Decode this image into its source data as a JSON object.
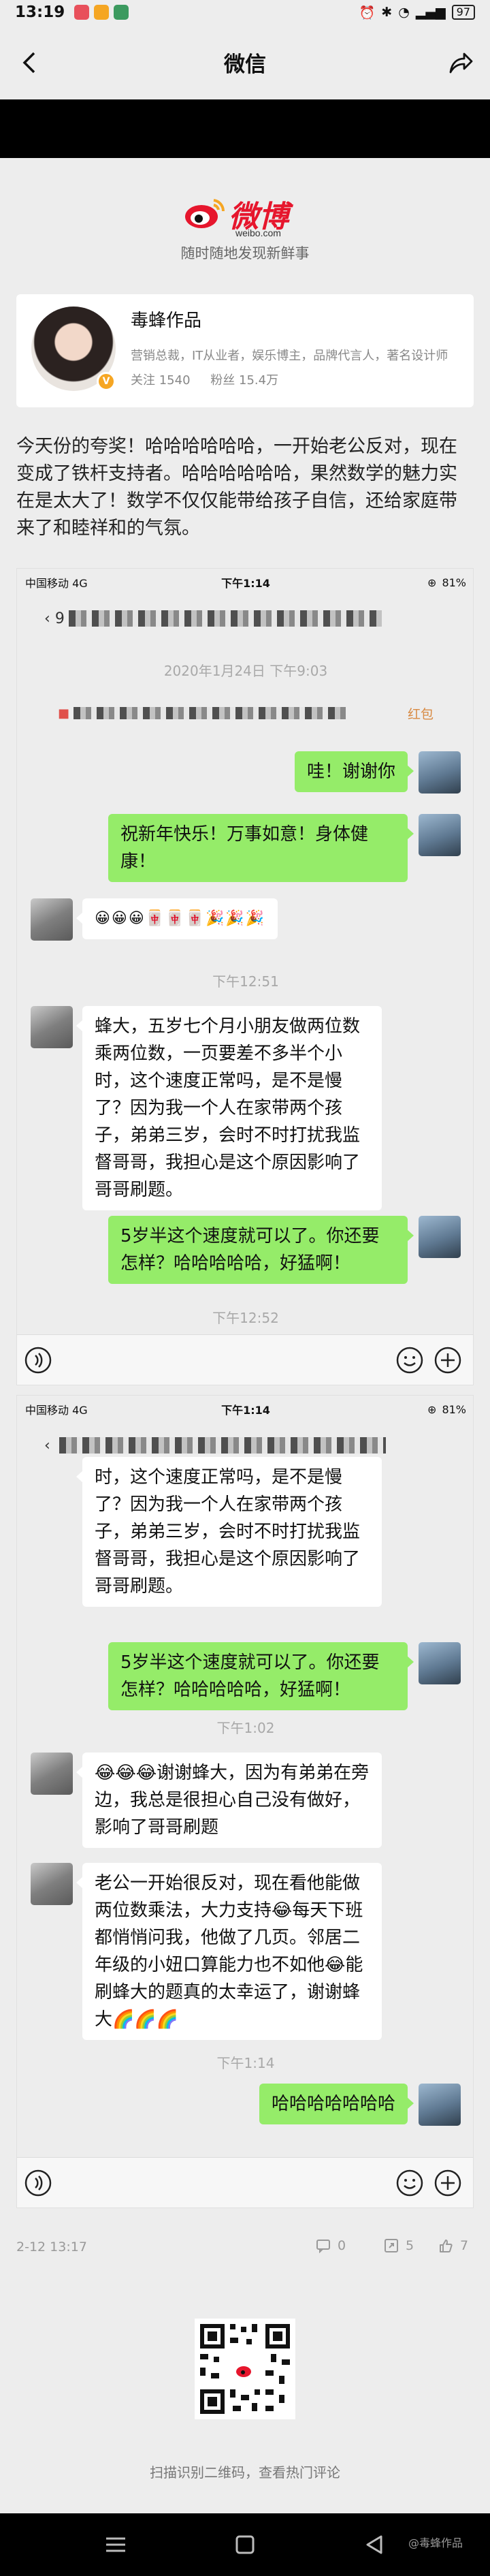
{
  "status_bar": {
    "time": "13:19",
    "battery": "97"
  },
  "header": {
    "title": "微信"
  },
  "weibo": {
    "logo_text": "微博",
    "url": "weibo.com",
    "slogan": "随时随地发现新鲜事"
  },
  "profile": {
    "name": "毒蜂作品",
    "desc": "营销总裁，IT从业者，娱乐博主，品牌代言人，著名设计师",
    "follow": "关注 1540",
    "fans": "粉丝 15.4万",
    "badge": "V"
  },
  "post_text": "今天份的夸奖！哈哈哈哈哈哈，一开始老公反对，现在变成了铁杆支持者。哈哈哈哈哈哈，果然数学的魅力实在是太大了！数学不仅仅能带给孩子自信，还给家庭带来了和睦祥和的气氛。",
  "shot1": {
    "carrier": "中国移动  4G",
    "time": "下午1:14",
    "battery": "81%",
    "chat_prefix": "9",
    "timestamp1": "2020年1月24日 下午9:03",
    "red_packet": "红包",
    "msg1": "哇！谢谢你",
    "msg2": "祝新年快乐！万事如意！身体健康！",
    "emoji_row": "😀😀😀🀄🀄🀄🎉🎉🎉",
    "timestamp2": "下午12:51",
    "msg3": "蜂大，五岁七个月小朋友做两位数乘两位数，一页要差不多半个小时，这个速度正常吗，是不是慢了？因为我一个人在家带两个孩子，弟弟三岁，会时不时打扰我监督哥哥，我担心是这个原因影响了哥哥刷题。",
    "msg4": "5岁半这个速度就可以了。你还要怎样？哈哈哈哈哈，好猛啊！",
    "timestamp3": "下午12:52"
  },
  "shot2": {
    "carrier": "中国移动  4G",
    "time": "下午1:14",
    "battery": "81%",
    "msg1": "时，这个速度正常吗，是不是慢了？因为我一个人在家带两个孩子，弟弟三岁，会时不时打扰我监督哥哥，我担心是这个原因影响了哥哥刷题。",
    "msg2": "5岁半这个速度就可以了。你还要怎样？哈哈哈哈哈，好猛啊！",
    "timestamp1": "下午1:02",
    "msg3": "😂😂😂谢谢蜂大，因为有弟弟在旁边，我总是很担心自己没有做好，影响了哥哥刷题",
    "msg4": "老公一开始很反对，现在看他能做两位数乘法，大力支持😂每天下班都悄悄问我，他做了几页。邻居二年级的小妞口算能力也不如他😂能刷蜂大的题真的太幸运了，谢谢蜂大🌈🌈🌈",
    "timestamp2": "下午1:14",
    "msg5": "哈哈哈哈哈哈哈"
  },
  "footer": {
    "date": "2-12 13:17",
    "comments": "0",
    "reposts": "5",
    "likes": "7",
    "qr_caption": "扫描识别二维码，查看热门评论",
    "watermark": "@毒蜂作品"
  },
  "colors": {
    "weibo_red": "#e6162d",
    "bubble_green": "#95ec69",
    "wechat_bg": "#ededed"
  }
}
